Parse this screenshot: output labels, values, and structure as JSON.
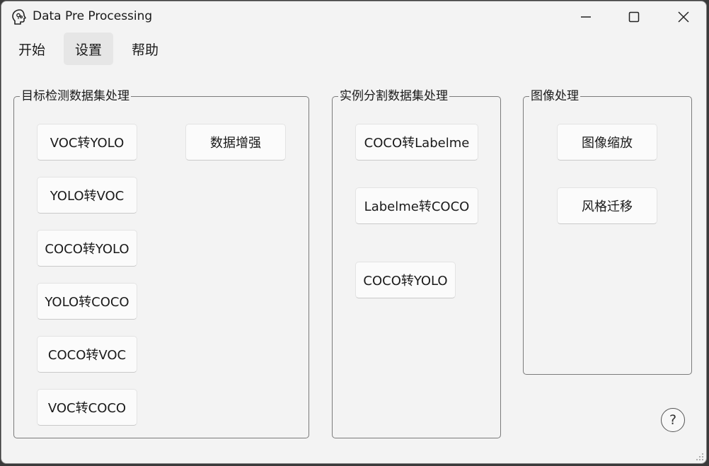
{
  "window": {
    "title": "Data Pre Processing",
    "controls": {
      "minimize": "minimize-icon",
      "maximize": "maximize-icon",
      "close": "close-icon"
    }
  },
  "menu": {
    "items": [
      {
        "label": "开始"
      },
      {
        "label": "设置",
        "active": true
      },
      {
        "label": "帮助"
      }
    ]
  },
  "groups": {
    "detection": {
      "title": "目标检测数据集处理",
      "buttons": [
        "VOC转YOLO",
        "YOLO转VOC",
        "COCO转YOLO",
        "YOLO转COCO",
        "COCO转VOC",
        "VOC转COCO",
        "数据增强"
      ]
    },
    "segmentation": {
      "title": "实例分割数据集处理",
      "buttons": [
        "COCO转Labelme",
        "Labelme转COCO",
        "COCO转YOLO"
      ]
    },
    "image": {
      "title": "图像处理",
      "buttons": [
        "图像缩放",
        "风格迁移"
      ]
    }
  },
  "help_button": {
    "label": "?"
  }
}
